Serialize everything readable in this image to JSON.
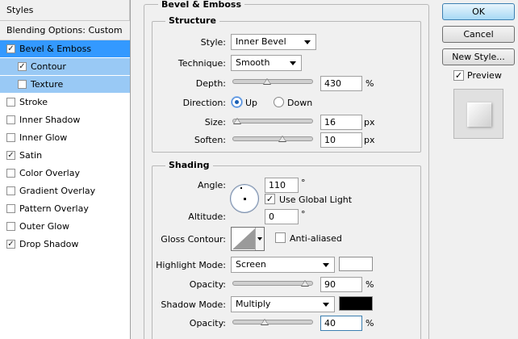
{
  "styles_panel": {
    "header": "Styles",
    "blending_options": "Blending Options: Custom",
    "items": [
      {
        "label": "Bevel & Emboss",
        "checked": true
      },
      {
        "label": "Contour",
        "checked": true
      },
      {
        "label": "Texture",
        "checked": false
      },
      {
        "label": "Stroke",
        "checked": false
      },
      {
        "label": "Inner Shadow",
        "checked": false
      },
      {
        "label": "Inner Glow",
        "checked": false
      },
      {
        "label": "Satin",
        "checked": true
      },
      {
        "label": "Color Overlay",
        "checked": false
      },
      {
        "label": "Gradient Overlay",
        "checked": false
      },
      {
        "label": "Pattern Overlay",
        "checked": false
      },
      {
        "label": "Outer Glow",
        "checked": false
      },
      {
        "label": "Drop Shadow",
        "checked": true
      }
    ]
  },
  "main": {
    "title": "Bevel & Emboss",
    "structure": {
      "title": "Structure",
      "style_label": "Style:",
      "style_value": "Inner Bevel",
      "technique_label": "Technique:",
      "technique_value": "Smooth",
      "depth_label": "Depth:",
      "depth_value": "430",
      "depth_unit": "%",
      "depth_slider": 0.43,
      "direction_label": "Direction:",
      "direction_up": "Up",
      "direction_down": "Down",
      "size_label": "Size:",
      "size_value": "16",
      "size_unit": "px",
      "size_slider": 0.06,
      "soften_label": "Soften:",
      "soften_value": "10",
      "soften_unit": "px",
      "soften_slider": 0.62
    },
    "shading": {
      "title": "Shading",
      "angle_label": "Angle:",
      "angle_value": "110",
      "angle_unit": "°",
      "use_global_light": "Use Global Light",
      "altitude_label": "Altitude:",
      "altitude_value": "0",
      "altitude_unit": "°",
      "gloss_contour_label": "Gloss Contour:",
      "anti_aliased": "Anti-aliased",
      "highlight_mode_label": "Highlight Mode:",
      "highlight_mode_value": "Screen",
      "highlight_color": "#ffffff",
      "highlight_opacity_label": "Opacity:",
      "highlight_opacity_value": "90",
      "highlight_opacity_unit": "%",
      "highlight_opacity_slider": 0.9,
      "shadow_mode_label": "Shadow Mode:",
      "shadow_mode_value": "Multiply",
      "shadow_color": "#000000",
      "shadow_opacity_label": "Opacity:",
      "shadow_opacity_value": "40",
      "shadow_opacity_unit": "%",
      "shadow_opacity_slider": 0.4
    }
  },
  "buttons": {
    "ok": "OK",
    "cancel": "Cancel",
    "new_style": "New Style...",
    "preview": "Preview"
  }
}
